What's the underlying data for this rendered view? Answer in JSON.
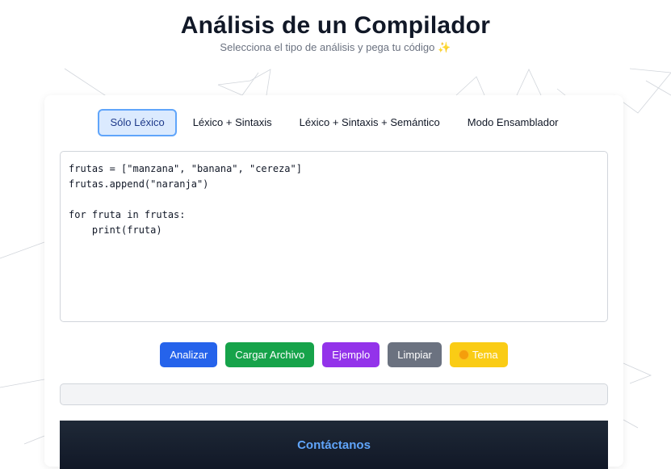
{
  "header": {
    "title": "Análisis de un Compilador",
    "subtitle": "Selecciona el tipo de análisis y pega tu código",
    "subtitle_icon": "sparkles-icon"
  },
  "tabs": [
    {
      "label": "Sólo Léxico",
      "active": true
    },
    {
      "label": "Léxico + Sintaxis",
      "active": false
    },
    {
      "label": "Léxico + Sintaxis + Semántico",
      "active": false
    },
    {
      "label": "Modo Ensamblador",
      "active": false
    }
  ],
  "editor": {
    "value": "frutas = [\"manzana\", \"banana\", \"cereza\"]\nfrutas.append(\"naranja\")\n\nfor fruta in frutas:\n    print(fruta)"
  },
  "buttons": {
    "analizar": "Analizar",
    "cargar": "Cargar Archivo",
    "ejemplo": "Ejemplo",
    "limpiar": "Limpiar",
    "tema": "Tema"
  },
  "output": {
    "value": ""
  },
  "footer": {
    "title": "Contáctanos"
  },
  "colors": {
    "accent": "#2563eb",
    "green": "#16a34a",
    "purple": "#9333ea",
    "gray": "#6b7280",
    "yellow": "#facc15",
    "footer_title": "#60a5fa"
  }
}
